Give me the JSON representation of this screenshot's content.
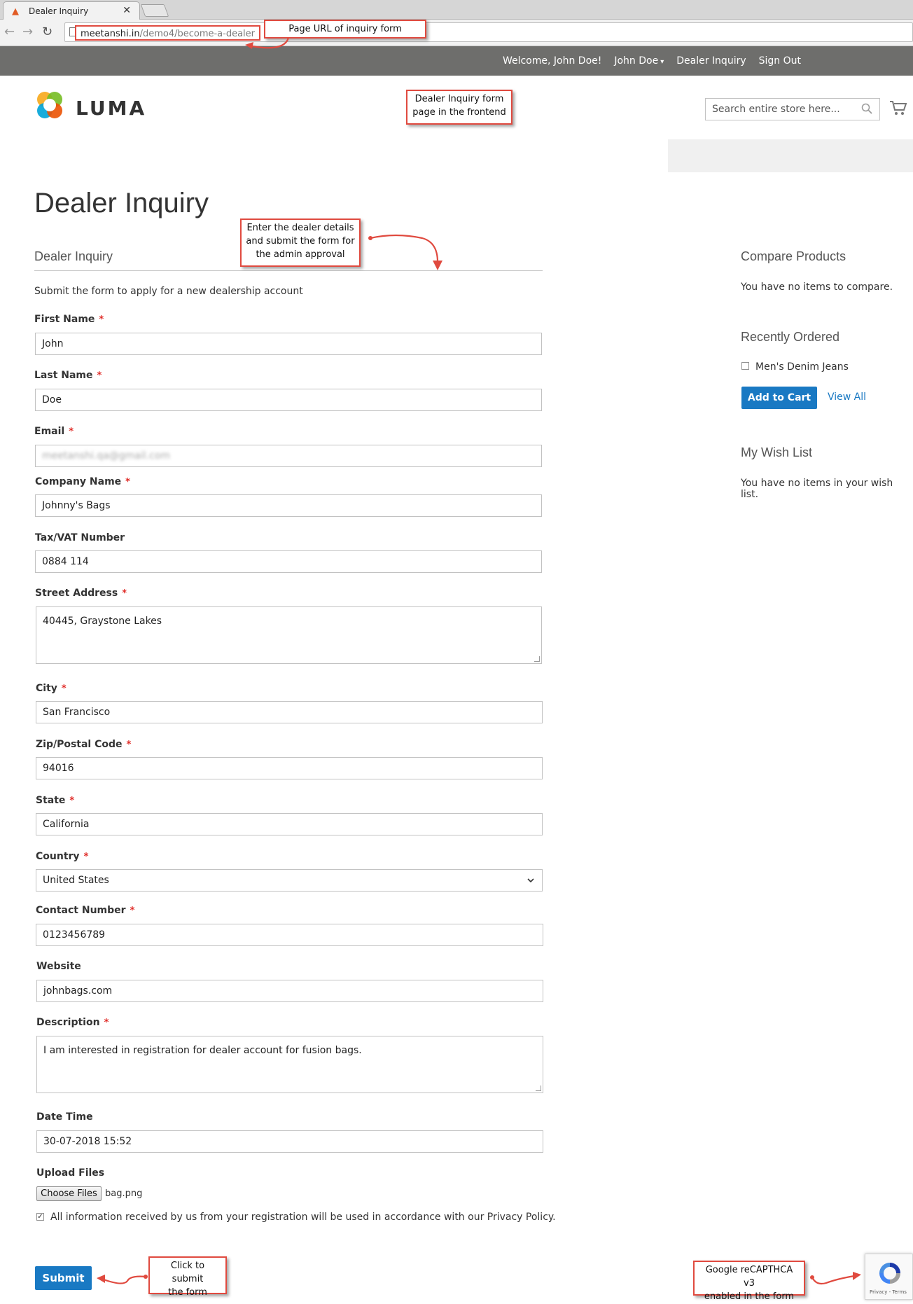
{
  "browser": {
    "tab_title": "Dealer Inquiry",
    "tab_close": "✕",
    "url_host": "meetanshi.in",
    "url_path": "/demo4/become-a-dealer"
  },
  "header": {
    "welcome": "Welcome, John Doe!",
    "account_name": "John Doe",
    "dealer_inquiry_link": "Dealer Inquiry",
    "sign_out": "Sign Out"
  },
  "logo_text": "LUMA",
  "search": {
    "placeholder": "Search entire store here..."
  },
  "main": {
    "page_title": "Dealer Inquiry",
    "legend": "Dealer Inquiry",
    "intro": "Submit the form to apply for a new dealership account"
  },
  "form": {
    "required_mark": "*",
    "first_name_label": "First Name",
    "first_name_value": "John",
    "last_name_label": "Last Name",
    "last_name_value": "Doe",
    "email_label": "Email",
    "email_value": "meetanshi.qa@gmail.com",
    "company_label": "Company Name",
    "company_value": "Johnny's Bags",
    "tax_label": "Tax/VAT Number",
    "tax_value": "0884 114",
    "street_label": "Street Address",
    "street_value": "40445, Graystone Lakes",
    "city_label": "City",
    "city_value": "San Francisco",
    "zip_label": "Zip/Postal Code",
    "zip_value": "94016",
    "state_label": "State",
    "state_value": "California",
    "country_label": "Country",
    "country_value": "United States",
    "contact_label": "Contact Number",
    "contact_value": "0123456789",
    "website_label": "Website",
    "website_value": "johnbags.com",
    "description_label": "Description",
    "description_value": "I am interested in registration for dealer account for fusion bags.",
    "datetime_label": "Date Time",
    "datetime_value": "30-07-2018 15:52",
    "upload_label": "Upload Files",
    "choose_files": "Choose Files",
    "file_name": "bag.png",
    "policy_text": "All information received by us from your registration will be used in accordance with our Privacy Policy.",
    "submit": "Submit"
  },
  "sidebar": {
    "compare_title": "Compare Products",
    "compare_text": "You have no items to compare.",
    "recent_title": "Recently Ordered",
    "recent_item": "Men's Denim Jeans",
    "add_to_cart": "Add to Cart",
    "view_all": "View All",
    "wishlist_title": "My Wish List",
    "wishlist_text": "You have no items in your wish list."
  },
  "annotations": {
    "url_note": "Page URL of inquiry form",
    "frontend_note_1": "Dealer Inquiry form",
    "frontend_note_2": "page in the frontend",
    "details_note_1": "Enter the dealer details",
    "details_note_2": "and submit the form for",
    "details_note_3": "the admin approval",
    "submit_note_1": "Click to submit",
    "submit_note_2": "the form",
    "captcha_note_1": "Google reCAPTHCA v3",
    "captcha_note_2": "enabled in the form"
  },
  "recaptcha": {
    "links": "Privacy - Terms"
  },
  "colors": {
    "primary_blue": "#1979c3",
    "header_grey": "#6e6e6c",
    "annotation_red": "#e04a3f",
    "required_red": "#e02b27"
  },
  "icons": [
    "magento-favicon",
    "back-arrow-icon",
    "forward-arrow-icon",
    "reload-icon",
    "page-icon",
    "chevron-down-icon",
    "luma-logo",
    "search-icon",
    "cart-icon",
    "recaptcha-icon"
  ]
}
